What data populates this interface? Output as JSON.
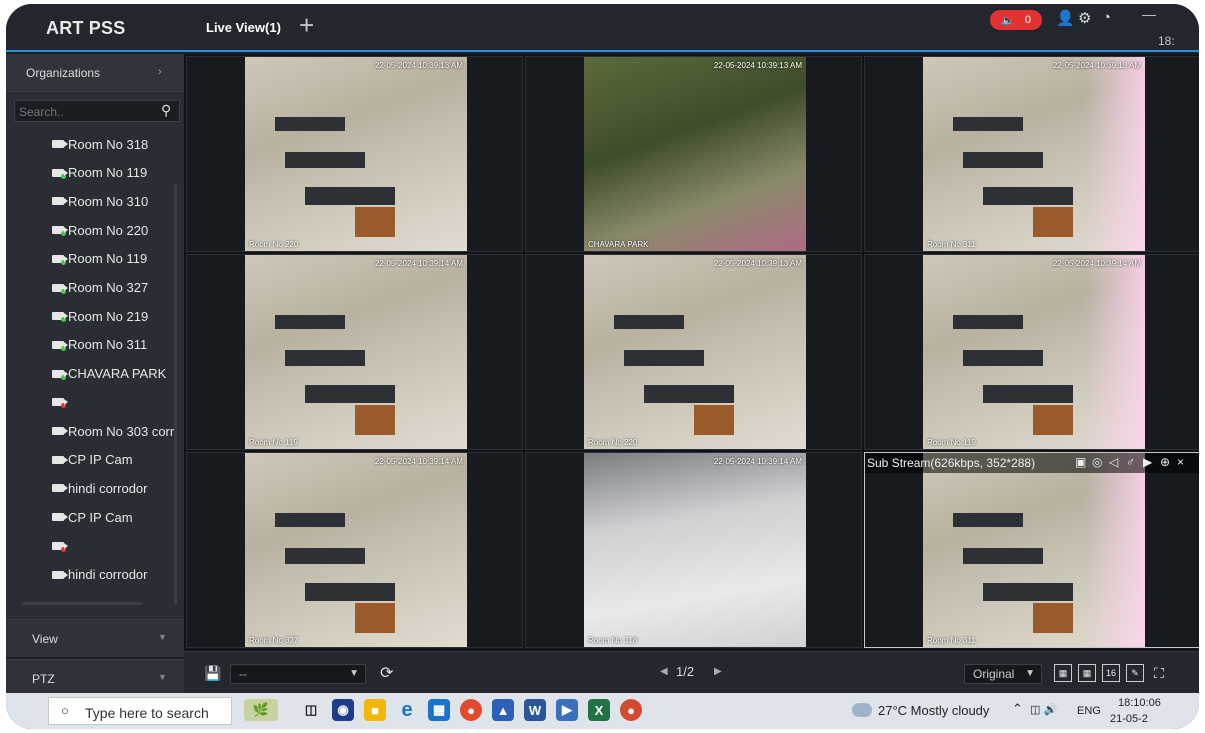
{
  "app": {
    "title": "ART PSS",
    "tab_label": "Live View(1)",
    "tab_add": "+",
    "alarm_count": "0",
    "clock": "18:"
  },
  "sidebar": {
    "organizations_label": "Organizations",
    "search_placeholder": "Search..",
    "devices": [
      {
        "label": "Room  No 318",
        "status": "default"
      },
      {
        "label": "Room  No 119",
        "status": "online"
      },
      {
        "label": "Room  No 310",
        "status": "default"
      },
      {
        "label": "Room  No 220",
        "status": "online"
      },
      {
        "label": "Room  No 119",
        "status": "online"
      },
      {
        "label": "Room  No 327",
        "status": "online"
      },
      {
        "label": "Room  No 219",
        "status": "online"
      },
      {
        "label": "Room  No 311",
        "status": "online"
      },
      {
        "label": "CHAVARA PARK",
        "status": "online"
      },
      {
        "label": "",
        "status": "offline"
      },
      {
        "label": "Room  No 303 corr",
        "status": "default"
      },
      {
        "label": "CP IP Cam",
        "status": "default"
      },
      {
        "label": "hindi corrodor",
        "status": "default"
      },
      {
        "label": "CP IP Cam",
        "status": "default"
      },
      {
        "label": "",
        "status": "offline"
      },
      {
        "label": "hindi corrodor",
        "status": "default"
      }
    ],
    "view_label": "View",
    "ptz_label": "PTZ"
  },
  "grid": {
    "cells": [
      {
        "timestamp": "22-05-2024 10:39:13 AM",
        "label": "Room No 220",
        "scene": "classroom"
      },
      {
        "timestamp": "22-05-2024 10:39:13 AM",
        "label": "CHAVARA PARK",
        "scene": "garden"
      },
      {
        "timestamp": "22-05-2024 10:39:13 AM",
        "label": "Room No 311",
        "scene": "classroom"
      },
      {
        "timestamp": "22-05-2024 10:39:14 AM",
        "label": "Room No 119",
        "scene": "classroom"
      },
      {
        "timestamp": "22-05-2024 10:39:13 AM",
        "label": "Room No 220",
        "scene": "classroom"
      },
      {
        "timestamp": "22-05-2024 10:39:14 AM",
        "label": "Room No 119",
        "scene": "classroom"
      },
      {
        "timestamp": "22-05-2024 10:39:14 AM",
        "label": "Room No 327",
        "scene": "classroom"
      },
      {
        "timestamp": "22-05-2024 10:39:14 AM",
        "label": "Room No 318",
        "scene": "corridor"
      },
      {
        "timestamp": "",
        "label": "Room No 311",
        "scene": "classroom"
      }
    ],
    "active_stream_info": "Sub Stream(626kbps, 352*288)"
  },
  "toolbar": {
    "view_select_value": "--",
    "page": "1/2",
    "scale_value": "Original",
    "layout_16": "16"
  },
  "taskbar": {
    "search_placeholder": "Type here to search",
    "weather": "27°C  Mostly cloudy",
    "language": "ENG",
    "time": "18:10:06",
    "date": "21-05-2"
  },
  "colors": {
    "accent": "#2a8fd8",
    "alarm": "#e23232",
    "online": "#3ed13e",
    "offline": "#e33333"
  }
}
